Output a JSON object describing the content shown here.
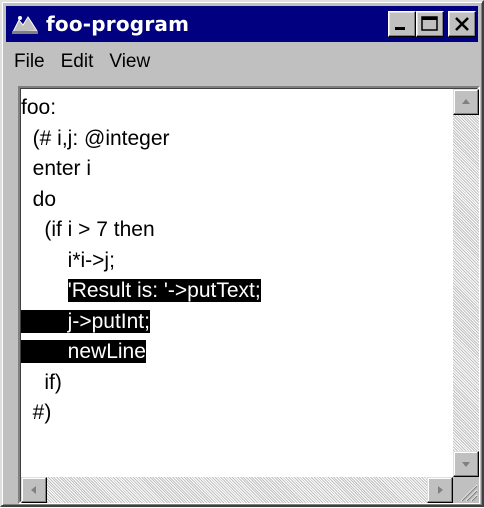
{
  "window": {
    "title": "foo-program",
    "icon": "foo-program-app-icon",
    "controls": [
      "minimize-icon",
      "maximize-icon",
      "close-icon"
    ]
  },
  "menu": {
    "items": [
      "File",
      "Edit",
      "View"
    ]
  },
  "editor": {
    "lines": [
      {
        "segments": [
          {
            "text": "foo:",
            "selected": false
          }
        ]
      },
      {
        "segments": [
          {
            "text": "  (# i,j: @integer",
            "selected": false
          }
        ]
      },
      {
        "segments": [
          {
            "text": "  enter i",
            "selected": false
          }
        ]
      },
      {
        "segments": [
          {
            "text": "  do",
            "selected": false
          }
        ]
      },
      {
        "segments": [
          {
            "text": "    (if i > 7 then",
            "selected": false
          }
        ]
      },
      {
        "segments": [
          {
            "text": "        i*i->j;",
            "selected": false
          }
        ]
      },
      {
        "segments": [
          {
            "text": "        ",
            "selected": false
          },
          {
            "text": "'Result is: '->putText;",
            "selected": true
          }
        ]
      },
      {
        "segments": [
          {
            "text": "        j->putInt;",
            "selected": true
          }
        ]
      },
      {
        "segments": [
          {
            "text": "        newLine",
            "selected": true
          }
        ]
      },
      {
        "segments": [
          {
            "text": "    if)",
            "selected": false
          }
        ]
      },
      {
        "segments": [
          {
            "text": "  #)",
            "selected": false
          }
        ]
      }
    ]
  },
  "scrollbars": {
    "vertical_buttons": [
      "scroll-up-icon",
      "scroll-down-icon"
    ],
    "horizontal_buttons": [
      "scroll-left-icon",
      "scroll-right-icon"
    ]
  },
  "colors": {
    "titlebar": "#000080",
    "face": "#c0c0c0",
    "selection": "#000000"
  }
}
